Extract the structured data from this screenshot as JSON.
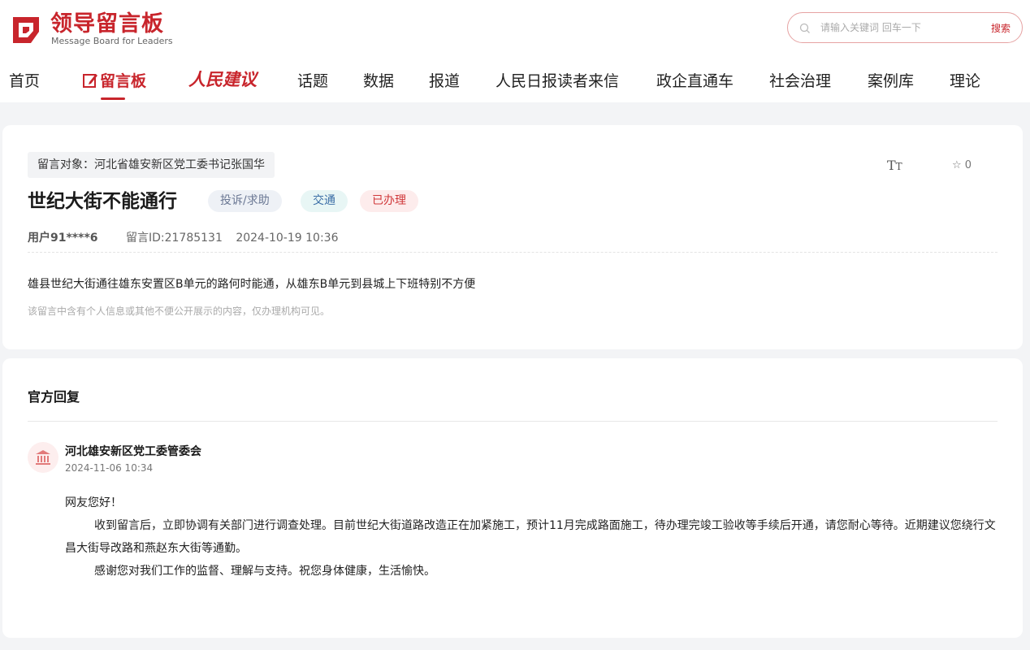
{
  "brand": {
    "title": "领导留言板",
    "subtitle": "Message Board for Leaders",
    "color": "#c8252c"
  },
  "search": {
    "placeholder": "请输入关键词 回车一下",
    "button": "搜索"
  },
  "nav": {
    "items": [
      "首页",
      "留言板",
      "人民建议",
      "话题",
      "数据",
      "报道",
      "人民日报读者来信",
      "政企直通车",
      "社会治理",
      "案例库",
      "理论"
    ],
    "active": "留言板"
  },
  "message": {
    "target": "留言对象：河北省雄安新区党工委书记张国华",
    "title": "世纪大街不能通行",
    "tags": {
      "type": "投诉/求助",
      "category": "交通",
      "status": "已办理"
    },
    "user": "用户91****6",
    "id": "留言ID:21785131",
    "date": "2024-10-19 10:36",
    "favorites": "0",
    "content": "雄县世纪大街通往雄东安置区B单元的路何时能通，从雄东B单元到县城上下班特别不方便",
    "privacy_note": "该留言中含有个人信息或其他不便公开展示的内容，仅办理机构可见。"
  },
  "reply": {
    "heading": "官方回复",
    "department": "河北雄安新区党工委管委会",
    "date": "2024-11-06 10:34",
    "greeting": "网友您好！",
    "paragraph1": "收到留言后，立即协调有关部门进行调查处理。目前世纪大街道路改造正在加紧施工，预计11月完成路面施工，待办理完竣工验收等手续后开通，请您耐心等待。近期建议您绕行文昌大街导改路和燕赵东大街等通勤。",
    "paragraph2": "感谢您对我们工作的监督、理解与支持。祝您身体健康，生活愉快。"
  }
}
